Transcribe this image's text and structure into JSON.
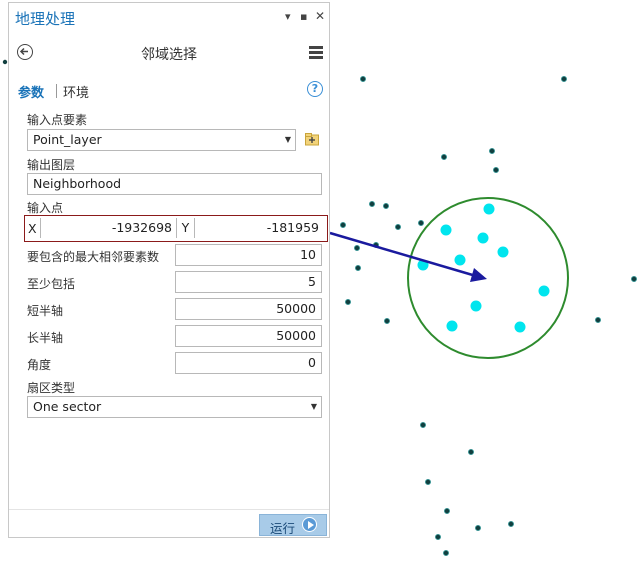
{
  "pane": {
    "title": "地理处理",
    "pin_glyph": "▾",
    "dock_glyph": "▪",
    "close_glyph": "✕",
    "tool_name": "邻域选择",
    "tabs": {
      "parameters": "参数",
      "environments": "环境"
    },
    "help_glyph": "?"
  },
  "params": {
    "input_label": "输入点要素",
    "input_value": "Point_layer",
    "output_label": "输出图层",
    "output_value": "Neighborhood",
    "point_label": "输入点",
    "x_label": "X",
    "x_value": "-1932698",
    "y_label": "Y",
    "y_value": "-181959",
    "max_label": "要包含的最大相邻要素数",
    "max_value": "10",
    "min_label": "至少包括",
    "min_value": "5",
    "minor_label": "短半轴",
    "minor_value": "50000",
    "major_label": "长半轴",
    "major_value": "50000",
    "angle_label": "角度",
    "angle_value": "0",
    "sector_label": "扇区类型",
    "sector_value": "One sector"
  },
  "run_label": "运行",
  "colors": {
    "accent": "#1a73b8",
    "selected_points": "#00e5ee",
    "points": "#123f3f",
    "circle": "#2e8b2e",
    "arrow": "#1a1a9e",
    "highlight_box": "#8b1a1a"
  }
}
